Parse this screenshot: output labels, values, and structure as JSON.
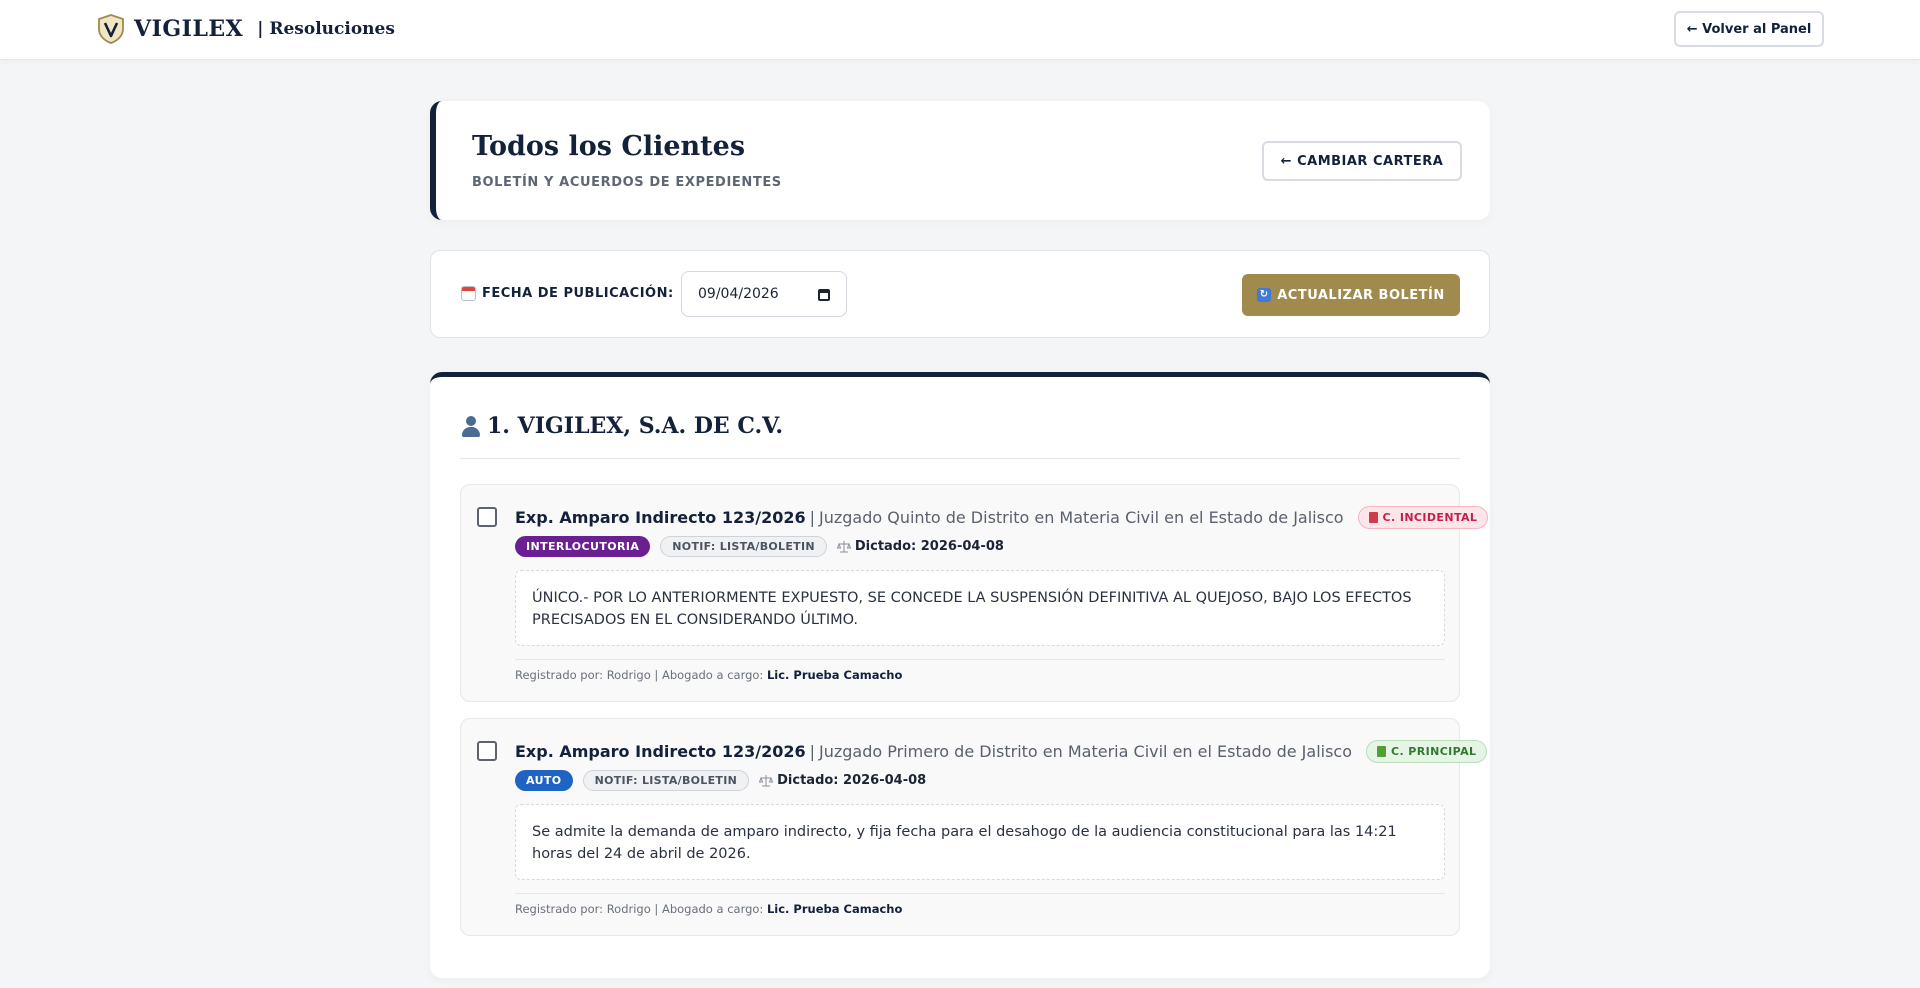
{
  "topbar": {
    "brand": "VIGILEX",
    "section": "| Resoluciones",
    "back_button": "← Volver al Panel"
  },
  "header": {
    "title": "Todos los Clientes",
    "subtitle": "BOLETÍN Y ACUERDOS DE EXPEDIENTES",
    "change_button": "← CAMBIAR CARTERA"
  },
  "filter": {
    "label": "FECHA DE PUBLICACIÓN:",
    "date_value": "09/04/2026",
    "update_button": "ACTUALIZAR BOLETÍN"
  },
  "client": {
    "title": "1. VIGILEX, S.A. DE C.V.",
    "entries": [
      {
        "expediente": "Exp. Amparo Indirecto 123/2026",
        "separator": "|",
        "court": "Juzgado Quinto de Distrito en Materia Civil en el Estado de Jalisco",
        "cuaderno": "C. INCIDENTAL",
        "type_tag": "INTERLOCUTORIA",
        "notif_tag": "NOTIF: LISTA/BOLETIN",
        "dictado": "Dictado: 2026-04-08",
        "acuerdo": "ÚNICO.- POR LO ANTERIORMENTE EXPUESTO, SE CONCEDE LA SUSPENSIÓN DEFINITIVA AL QUEJOSO, BAJO LOS EFECTOS PRECISADOS EN EL CONSIDERANDO ÚLTIMO.",
        "registro_prefix": "Registrado por: Rodrigo | Abogado a cargo:",
        "lawyer": "Lic. Prueba Camacho"
      },
      {
        "expediente": "Exp. Amparo Indirecto 123/2026",
        "separator": "|",
        "court": "Juzgado Primero de Distrito en Materia Civil en el Estado de Jalisco",
        "cuaderno": "C. PRINCIPAL",
        "type_tag": "AUTO",
        "notif_tag": "NOTIF: LISTA/BOLETIN",
        "dictado": "Dictado: 2026-04-08",
        "acuerdo": "Se admite la demanda de amparo indirecto, y fija fecha para el desahogo de la audiencia constitucional para las 14:21 horas del 24 de abril de 2026.",
        "registro_prefix": "Registrado por: Rodrigo | Abogado a cargo:",
        "lawyer": "Lic. Prueba Camacho"
      }
    ]
  },
  "colors": {
    "navy": "#13213a",
    "gold": "#a08a4d",
    "interlocutoria": "#6a2092",
    "auto": "#1f63c4",
    "incidental": "#c41f4a",
    "principal": "#2f7a2f"
  },
  "icons": {
    "logo": "vigilex-shield-logo",
    "calendar": "calendar-icon",
    "refresh": "refresh-icon",
    "person": "person-icon",
    "book": "book-icon",
    "scale": "scale-icon"
  }
}
